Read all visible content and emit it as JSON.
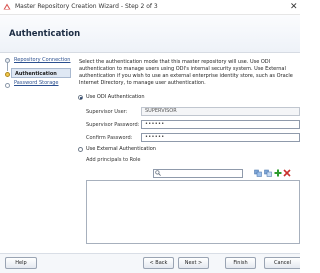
{
  "window": {
    "title": "Master Repository Creation Wizard - Step 2 of 3",
    "close_glyph": "✕"
  },
  "header": {
    "title": "Authentication"
  },
  "steps": [
    {
      "label": "Repository Connection",
      "state": "done"
    },
    {
      "label": "Authentication",
      "state": "current"
    },
    {
      "label": "Password Storage",
      "state": "pending"
    }
  ],
  "main": {
    "description": "Select the authentication mode that this master repository will use. Use ODI authentication to manage users using ODI's internal security system. Use External authentication if you wish to use an external enterprise identity store, such as Oracle Internet Directory, to manage user authentication.",
    "odi_auth": {
      "label": "Use ODI Authentication",
      "selected": true,
      "supervisor_user_label": "Supervisor User:",
      "supervisor_user_value": "SUPERVISOR",
      "supervisor_password_label": "Supervisor Password:",
      "supervisor_password_value": "••••••",
      "confirm_password_label": "Confirm Password:",
      "confirm_password_value": "••••••"
    },
    "external_auth": {
      "label": "Use External Authentication",
      "selected": false,
      "principals_label": "Add principals to Role"
    }
  },
  "footer": {
    "help": "Help",
    "back": "< Back",
    "next": "Next >",
    "finish": "Finish",
    "cancel": "Cancel"
  },
  "colors": {
    "accent": "#2a4f8f",
    "current_step": "#f2c84b",
    "add_icon": "#2e9c2e",
    "remove_icon": "#c9302c"
  }
}
